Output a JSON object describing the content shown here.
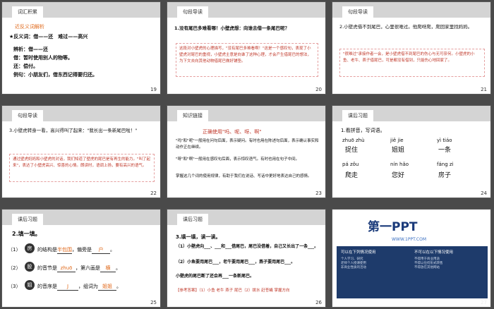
{
  "slides": {
    "s19": {
      "title": "词汇积累",
      "subtitle": "近反义词解析",
      "line1": "★反义词：借——还　难过——高兴",
      "line2": "辨析：借——还",
      "line3": "借：暂时使用别人的物等。",
      "line4": "还：偿付。",
      "line5": "例句：小朋友们，借东西记得要归还。",
      "page": "19"
    },
    "s20": {
      "title": "句段导读",
      "question": "1.没有尾巴多难看哪！小壁虎想：向谁去借一条尾巴呢？",
      "note": "这段对小壁虎的心理描写，\"没有尾巴多难看啊！\"这是一个感叹句，表现了小壁虎对尾巴的重视，小壁虎主意是向谁了这种心理，才会产生借尾巴的想法，为下文去向其他动物借尾巴做好铺垫。",
      "page": "20"
    },
    "s21": {
      "title": "句段导读",
      "question": "2.小壁虎借不到尾巴，心里很难过。他爬呀爬，爬回家里找妈妈。",
      "note": "\"很难过\"承接作者一会，是小壁虎借不到尾巴的伤心与无可奈何。小壁虎的小鱼、老牛、燕子借尾巴，可是都没有借到，只能伤心地回家了。",
      "page": "21"
    },
    "s22": {
      "title": "句段导读",
      "question": "3.小壁虎转身一看，高兴得叫了起来：\"我长出一条新尾巴啦！\"",
      "note": "通过壁虎妈妈和小壁虎的对话，我们知道了壁虎的尾巴是有再生的能力。\"叫了起来\"，表达了小壁虎高兴、惊喜的心情。朗读时，语调上扬，要有高兴的语气。",
      "page": "22"
    },
    "s23": {
      "title": "知识链接",
      "heading": "正确使用\"吗、呢、呀、啊\"",
      "p1": "\"吗\"和\"呢\"一般用在问句后面，表示疑问。有时也用在陈述句后面，表示确认事实和动作正在继续。",
      "p2": "\"呀\"和\"啊\"一般用在感叹句后面，表示惊叹语气。有时也用在句子中间。",
      "p3": "掌握这几个词的使用规律，有助于我们在说话、写话中更好地表达自己的感情。",
      "page": "23"
    },
    "s24": {
      "title": "课后习题",
      "instruction": "1.看拼音，写词语。",
      "pinyin": [
        "zhuō zhù",
        "jiě jie",
        "yì tiáo",
        "pá zǒu",
        "nín hǎo",
        "fáng zi"
      ],
      "words": [
        "捉住",
        "姐姐",
        "一条",
        "爬走",
        "您好",
        "房子"
      ],
      "page": "24"
    },
    "s25": {
      "title": "课后习题",
      "instruction": "2.填一填。",
      "rows": [
        {
          "num": "（1）",
          "char": "房",
          "text1": "的结构是",
          "answer1": "半包围",
          "text2": "，偏旁是",
          "answer2": "户",
          "text3": "。"
        },
        {
          "num": "（2）",
          "char": "股",
          "text1": "的音节是",
          "answer1": "zhuō",
          "text2": "，第六画是",
          "answer2": "横",
          "text3": "。"
        },
        {
          "num": "（3）",
          "char": "姐",
          "text1": "的音序是",
          "answer1": "J",
          "text2": "，组词为",
          "answer2": "姐姐",
          "text3": "。"
        }
      ],
      "page": "25"
    },
    "s26": {
      "title": "课后习题",
      "instruction": "3.填一填，读一读。",
      "line1": "（1）小壁虎向___、___和___借尾巴，尾巴没借着，自己又长出了一条___。",
      "line2": "（2）小鱼要用尾巴___，老牛要用尾巴___，燕子要用尾巴___。",
      "line3": "小壁虎的尾巴断了还会再___一条新尾巴。",
      "answer": "【参考答案】（1）小鱼 老牛 燕子 尾巴（2）拨水 赶苍蝇 掌握方向",
      "page": "26"
    },
    "s27": {
      "logo": "第一PPT",
      "url": "WWW.1PPT.COM",
      "left_head": "可以在下列情况使用",
      "right_head": "不可以在以下情况使用",
      "left_lines": [
        "个人学习、研究",
        "老师个人授课使用",
        "非商业性质的活动"
      ],
      "right_lines": [
        "不得用于商业用途",
        "不得以任何形式转售",
        "不得放在其他网站"
      ],
      "page": "27"
    }
  },
  "colors": {
    "accent": "#c0392b",
    "orange": "#e06a1c",
    "dark_blue": "#1e3b6b"
  }
}
